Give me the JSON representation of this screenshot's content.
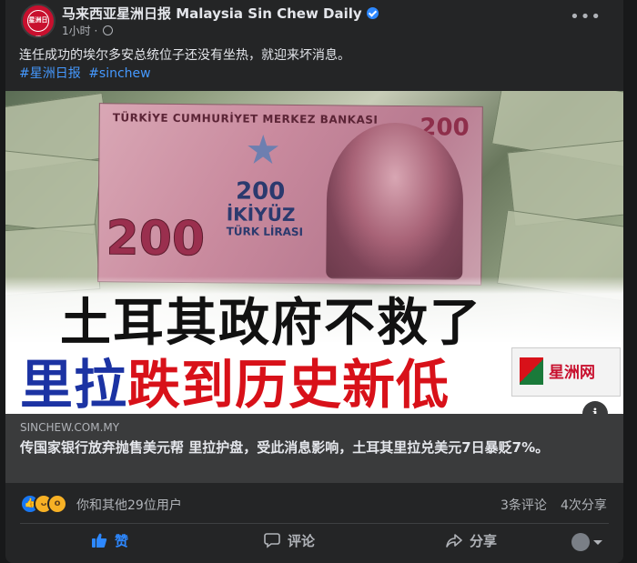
{
  "post": {
    "page_name": "马来西亚星洲日报 Malaysia Sin Chew Daily",
    "time": "1小时",
    "visibility_separator": "·",
    "text": "连任成功的埃尔多安总统位子还没有坐热，就迎来坏消息。",
    "hashtags": [
      "#星洲日报",
      "#sinchew"
    ],
    "avatar_text": "星洲日报",
    "more_label": "•••"
  },
  "image": {
    "banknote_bank": "TÜRKİYE CUMHURİYET MERKEZ BANKASI",
    "banknote_value": "200",
    "banknote_word": "İKİYÜZ",
    "banknote_currency": "TÜRK LİRASI",
    "headline_line1": "土耳其政府不救了",
    "headline_line2_blue": "里拉",
    "headline_line2_red": "跌到历史新低",
    "logo_text": "星洲网",
    "info_label": "i"
  },
  "link": {
    "domain": "SINCHEW.COM.MY",
    "title": "传国家银行放弃抛售美元帮 里拉护盘，受此消息影响，土耳其里拉兑美元7日暴贬7%。"
  },
  "engagement": {
    "reaction_text": "你和其他29位用户",
    "comments": "3条评论",
    "shares": "4次分享"
  },
  "actions": {
    "like": "赞",
    "comment": "评论",
    "share": "分享"
  }
}
